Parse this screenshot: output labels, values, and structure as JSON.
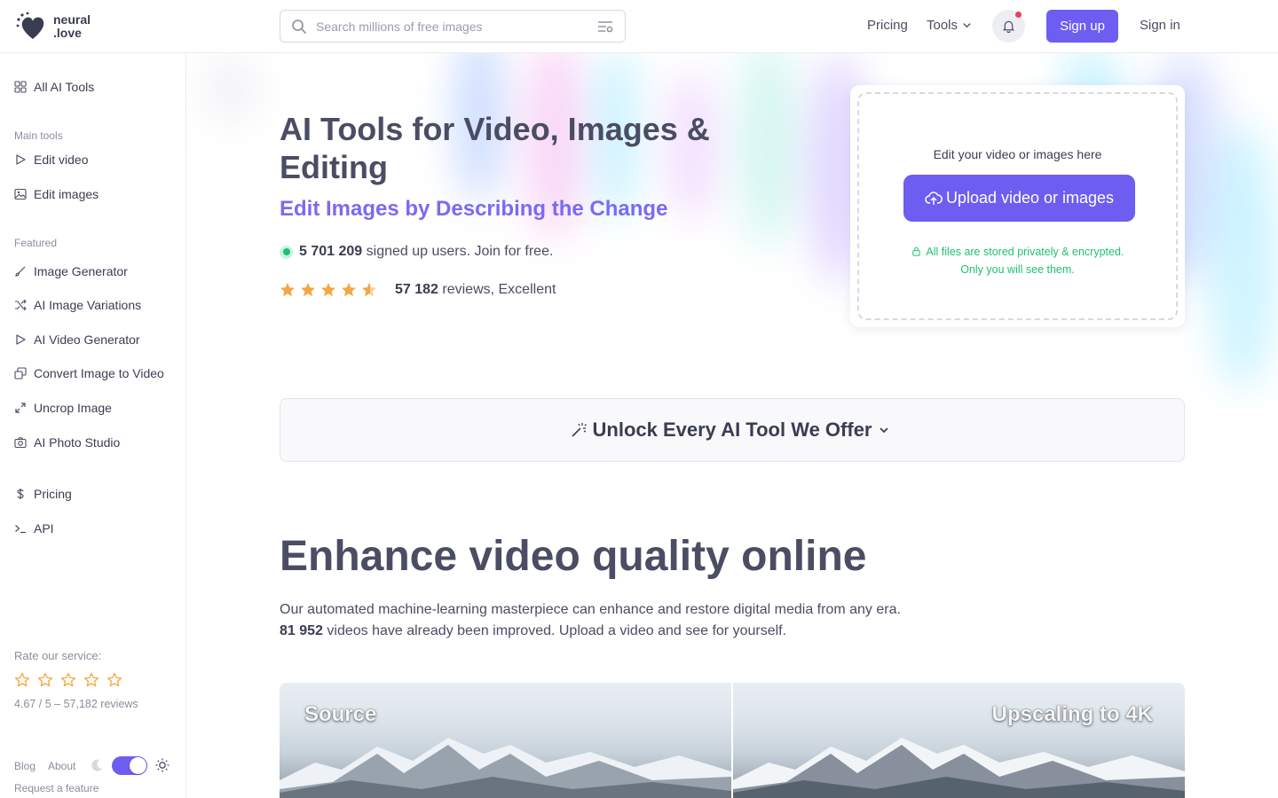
{
  "header": {
    "logo_line1": "neural",
    "logo_line2": ".love",
    "search_placeholder": "Search millions of free images",
    "nav_pricing": "Pricing",
    "nav_tools": "Tools",
    "signup": "Sign up",
    "signin": "Sign in"
  },
  "sidebar": {
    "all_tools": "All AI Tools",
    "main_section": "Main tools",
    "main_items": [
      "Edit video",
      "Edit images"
    ],
    "featured_section": "Featured",
    "featured_items": [
      "Image Generator",
      "AI Image Variations",
      "AI Video Generator",
      "Convert Image to Video",
      "Uncrop Image",
      "AI Photo Studio"
    ],
    "pricing": "Pricing",
    "api": "API",
    "rate_label": "Rate our service:",
    "rate_summary": "4.67 / 5 – 57,182 reviews",
    "footer": {
      "blog": "Blog",
      "about": "About",
      "request": "Request a feature"
    },
    "dark_mode_toggle_on": true
  },
  "hero": {
    "title": "AI Tools for Video, Images & Editing",
    "subtitle": "Edit Images by Describing the Change",
    "users_count": "5 701 209",
    "users_text": " signed up users. Join for free.",
    "reviews_count": "57 182",
    "reviews_text": " reviews, Excellent",
    "rating_stars": 4.5
  },
  "upload": {
    "hint": "Edit your video or images here",
    "button": "Upload video or images",
    "secure_line1": "All files are stored privately & encrypted.",
    "secure_line2": "Only you will see them."
  },
  "unlock": {
    "label": "Unlock Every AI Tool We Offer"
  },
  "enhance": {
    "title": "Enhance video quality online",
    "desc_line1": "Our automated machine-learning masterpiece can enhance and restore digital media from any era.",
    "videos_count": "81 952",
    "desc_line2": " videos have already been improved. Upload a video and see for yourself."
  },
  "compare": {
    "left_label": "Source",
    "right_label": "Upscaling to 4K"
  },
  "colors": {
    "accent": "#6d5df0",
    "accent_text": "#7a6af3",
    "star": "#f5a742",
    "success": "#1fbf77",
    "notification": "#ef3d60"
  }
}
